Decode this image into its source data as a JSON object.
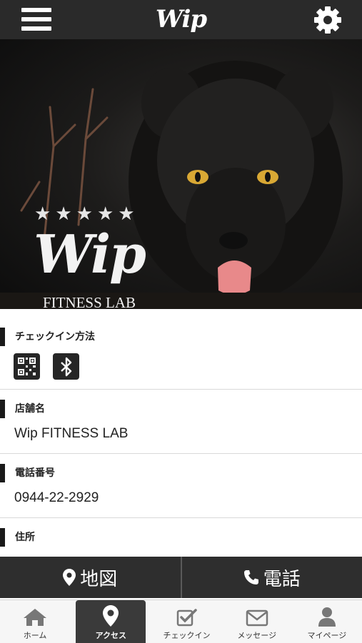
{
  "header": {
    "logo": "Wip"
  },
  "hero": {
    "logo": "Wip",
    "subtitle": "FITNESS LAB",
    "stars": [
      "★",
      "★",
      "★",
      "★",
      "★"
    ]
  },
  "checkin": {
    "label": "チェックイン方法",
    "icons": [
      "qr-code-icon",
      "bluetooth-icon"
    ]
  },
  "store": {
    "label": "店舗名",
    "value": "Wip FITNESS LAB"
  },
  "phone": {
    "label": "電話番号",
    "value": "0944-22-2929"
  },
  "address": {
    "label": "住所"
  },
  "actions": {
    "map": "地図",
    "call": "電話"
  },
  "tabs": [
    {
      "label": "ホーム",
      "icon": "home-icon"
    },
    {
      "label": "アクセス",
      "icon": "map-pin-icon",
      "active": true
    },
    {
      "label": "チェックイン",
      "icon": "checkin-icon"
    },
    {
      "label": "メッセージ",
      "icon": "envelope-icon"
    },
    {
      "label": "マイページ",
      "icon": "person-icon"
    }
  ],
  "colors": {
    "bar": "#2a2a2a",
    "accent": "#1a1a1a"
  }
}
